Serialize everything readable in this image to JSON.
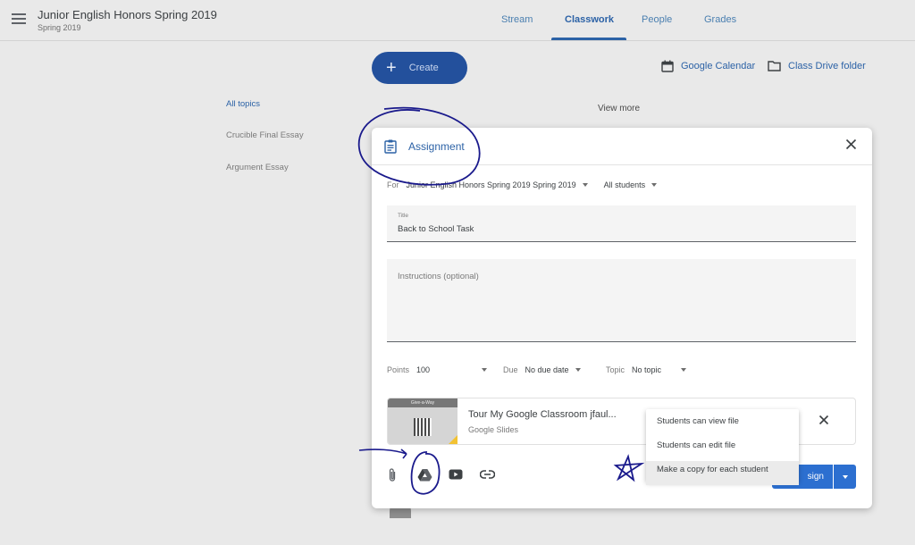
{
  "header": {
    "class_title": "Junior English Honors Spring 2019",
    "class_subtitle": "Spring 2019",
    "tabs": [
      {
        "label": "Stream"
      },
      {
        "label": "Classwork"
      },
      {
        "label": "People"
      },
      {
        "label": "Grades"
      }
    ],
    "active_tab": "Classwork"
  },
  "classwork": {
    "create_label": "Create",
    "calendar_label": "Google Calendar",
    "drive_label": "Class Drive folder",
    "topics": [
      "All topics",
      "Crucible Final Essay",
      "Argument Essay"
    ],
    "view_more": "View more"
  },
  "dialog": {
    "title": "Assignment",
    "for_label": "For",
    "class_select": "Junior English Honors Spring 2019 Spring 2019",
    "students_select": "All students",
    "title_field_label": "Title",
    "title_value": "Back to School Task",
    "instructions_placeholder": "Instructions (optional)",
    "points_label": "Points",
    "points_value": "100",
    "due_label": "Due",
    "due_value": "No due date",
    "topic_label": "Topic",
    "topic_value": "No topic",
    "attachment": {
      "title": "Tour My Google Classroom jfaul...",
      "type": "Google Slides",
      "thumb_caption": "Give-a-Way"
    },
    "assign_label": "sign",
    "icons": [
      "paperclip-icon",
      "google-drive-icon",
      "youtube-icon",
      "link-icon"
    ]
  },
  "share_menu": {
    "items": [
      "Students can view file",
      "Students can edit file",
      "Make a copy for each student"
    ],
    "highlighted": "Make a copy for each student"
  },
  "colors": {
    "accent": "#2c62a6",
    "create_button": "#23509c",
    "assign_button": "#2c6fd0",
    "annotation_ink": "#1a1a8c"
  }
}
